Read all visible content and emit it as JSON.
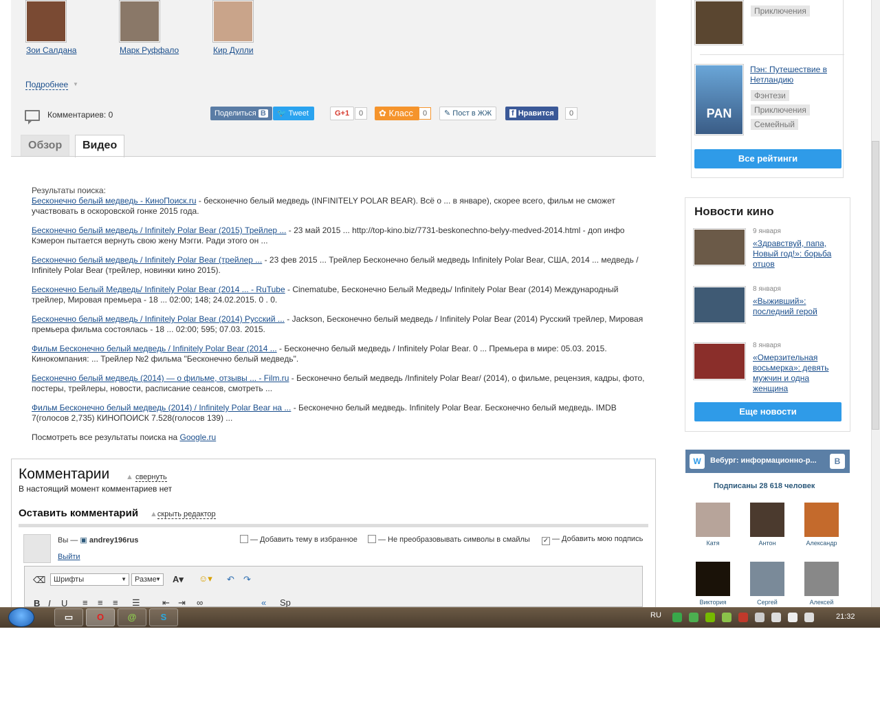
{
  "actors": [
    {
      "name": "Зои Салдана",
      "color": "#7a4a33"
    },
    {
      "name": "Марк Руффало",
      "color": "#8a7868"
    },
    {
      "name": "Кир Дулли",
      "color": "#c9a48a"
    }
  ],
  "more_link": "Подробнее",
  "comments_count": "Комментариев: 0",
  "share": {
    "vk": "Поделиться",
    "tweet": "Tweet",
    "gplus": "G+1",
    "gplus_count": "0",
    "ok": "Класс",
    "ok_count": "0",
    "lj": "Пост в ЖЖ",
    "fb": "Нравится",
    "fb_count": "0"
  },
  "tabs": {
    "overview": "Обзор",
    "video": "Видео"
  },
  "search": {
    "header": "Результаты поиска:",
    "results": [
      {
        "title": "Бесконечно белый медведь - КиноПоиск.ru",
        "snippet": " - бесконечно белый медведь (INFINITELY POLAR BEAR). Всё о ... в январе), скорее всего, фильм не сможет участвовать в оскоровской гонке 2015 года."
      },
      {
        "title": "Бесконечно белый медведь / Infinitely Polar Bear (2015) Трейлер ...",
        "snippet": " - 23 май 2015 ... http://top-kino.biz/7731-beskonechno-belyy-medved-2014.html - доп инфо Кэмерон пытается вернуть свою жену Мэгги. Ради этого он ..."
      },
      {
        "title": "Бесконечно белый медведь / Infinitely Polar Bear (трейлер ...",
        "snippet": " - 23 фев 2015 ... Трейлер Бесконечно белый медведь Infinitely Polar Bear, США, 2014 ... медведь / Infinitely Polar Bear (трейлер, новинки кино 2015)."
      },
      {
        "title": "Бесконечно Белый Медведь/ Infinitely Polar Bear (2014 ... - RuTube",
        "snippet": " - Cinematube, Бесконечно Белый Медведь/ Infinitely Polar Bear (2014) Международный трейлер, Мировая премьера - 18 ... 02:00; 148; 24.02.2015. 0 . 0."
      },
      {
        "title": "Бесконечно белый медведь / Infinitely Polar Bear (2014) Русский ...",
        "snippet": " - Jackson, Бесконечно белый медведь / Infinitely Polar Bear (2014) Русский трейлер, Мировая премьера фильма состоялась - 18 ... 02:00; 595; 07.03. 2015."
      },
      {
        "title": "Фильм Бесконечно белый медведь / Infinitely Polar Bear (2014 ...",
        "snippet": " - Бесконечно белый медведь / Infinitely Polar Bear. 0 ... Премьера в мире: 05.03. 2015. Кинокомпания: ... Трейлер №2 фильма \"Бесконечно белый медведь\"."
      },
      {
        "title": "Бесконечно белый медведь (2014) — о фильме, отзывы ... - Film.ru",
        "snippet": " - Бесконечно белый медведь /Infinitely Polar Bear/ (2014), о фильме, рецензия, кадры, фото, постеры, трейлеры, новости, расписание сеансов, смотреть ..."
      },
      {
        "title": "Фильм Бесконечно белый медведь (2014) / Infinitely Polar Bear на ...",
        "snippet": " - Бесконечно белый медведь. Infinitely Polar Bear. Бесконечно белый медведь. IMDB 7(голосов 2,735) КИНОПОИСК 7.528(голосов 139) ..."
      }
    ],
    "google_prefix": "Посмотреть все результаты поиска на ",
    "google_link": "Google.ru"
  },
  "comments": {
    "title": "Комментарии",
    "collapse": "свернуть",
    "none": "В настоящий момент комментариев нет",
    "leave": "Оставить комментарий",
    "hide_editor": "скрыть редактор",
    "you": "Вы — ",
    "user": "andrey196rus",
    "logout": "Выйти",
    "chk_fav": "— Добавить тему в избранное",
    "chk_smiles": "— Не преобразовывать символы в смайлы",
    "chk_sign": "— Добавить мою подпись",
    "font_select": "Шрифты",
    "size_select": "Разме"
  },
  "right": {
    "tag_top": "Приключения",
    "movie_link": "Пэн: Путешествие в Нетландию",
    "movie_tags": [
      "Фэнтези",
      "Приключения",
      "Семейный"
    ],
    "poster_text": "PAN",
    "all_ratings": "Все рейтинги",
    "news_title": "Новости кино",
    "news": [
      {
        "date": "9 января",
        "text": "«Здравствуй, папа, Новый год!»: борьба отцов",
        "color": "#6b5a48"
      },
      {
        "date": "8 января",
        "text": "«Выживший»: последний герой",
        "color": "#3f5a74"
      },
      {
        "date": "8 января",
        "text": "«Омерзительная восьмерка»: девять мужчин и одна женщина",
        "color": "#8a2e2a"
      }
    ],
    "more_news": "Еще новости",
    "vk_title": "Вебург: информационно-р...",
    "vk_subs": "Подписаны 28 618 человек",
    "vk_people": [
      {
        "name": "Катя",
        "color": "#b7a49a"
      },
      {
        "name": "Антон",
        "color": "#4b3a2e"
      },
      {
        "name": "Александр",
        "color": "#c46a2c"
      },
      {
        "name": "Виктория",
        "color": "#1a1208"
      },
      {
        "name": "Сергей",
        "color": "#7a8a99"
      },
      {
        "name": "Алексей",
        "color": "#888888"
      }
    ]
  },
  "taskbar": {
    "lang": "RU",
    "clock": "21:32"
  }
}
